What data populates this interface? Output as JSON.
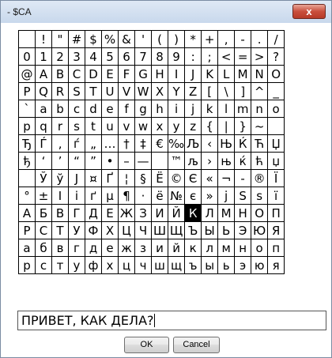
{
  "window": {
    "title": "- $CA",
    "close_label": "x"
  },
  "grid": {
    "rows": [
      [
        " ",
        "!",
        "\"",
        "#",
        "$",
        "%",
        "&",
        "'",
        "(",
        ")",
        "*",
        "+",
        ",",
        "-",
        ".",
        "/"
      ],
      [
        "0",
        "1",
        "2",
        "3",
        "4",
        "5",
        "6",
        "7",
        "8",
        "9",
        ":",
        ";",
        "<",
        "=",
        ">",
        "?"
      ],
      [
        "@",
        "A",
        "B",
        "C",
        "D",
        "E",
        "F",
        "G",
        "H",
        "I",
        "J",
        "K",
        "L",
        "M",
        "N",
        "O"
      ],
      [
        "P",
        "Q",
        "R",
        "S",
        "T",
        "U",
        "V",
        "W",
        "X",
        "Y",
        "Z",
        "[",
        "\\",
        "]",
        "^",
        "_"
      ],
      [
        "`",
        "a",
        "b",
        "c",
        "d",
        "e",
        "f",
        "g",
        "h",
        "i",
        "j",
        "k",
        "l",
        "m",
        "n",
        "o"
      ],
      [
        "p",
        "q",
        "r",
        "s",
        "t",
        "u",
        "v",
        "w",
        "x",
        "y",
        "z",
        "{",
        "|",
        "}",
        "~",
        " "
      ],
      [
        "Ђ",
        "Ѓ",
        "‚",
        "ѓ",
        "„",
        "…",
        "†",
        "‡",
        "€",
        "‰",
        "Љ",
        "‹",
        "Њ",
        "Ќ",
        "Ћ",
        "Џ"
      ],
      [
        "ђ",
        "‘",
        "’",
        "“",
        "”",
        "•",
        "–",
        "—",
        " ",
        "™",
        "љ",
        "›",
        "њ",
        "ќ",
        "ћ",
        "џ"
      ],
      [
        " ",
        "Ў",
        "ў",
        "Ј",
        "¤",
        "Ґ",
        "¦",
        "§",
        "Ё",
        "©",
        "Є",
        "«",
        "¬",
        "-",
        "®",
        "Ї"
      ],
      [
        "°",
        "±",
        "І",
        "і",
        "ґ",
        "µ",
        "¶",
        "·",
        "ё",
        "№",
        "є",
        "»",
        "ј",
        "Ѕ",
        "ѕ",
        "ї"
      ],
      [
        "А",
        "Б",
        "В",
        "Г",
        "Д",
        "Е",
        "Ж",
        "З",
        "И",
        "Й",
        "К",
        "Л",
        "М",
        "Н",
        "О",
        "П"
      ],
      [
        "Р",
        "С",
        "Т",
        "У",
        "Ф",
        "Х",
        "Ц",
        "Ч",
        "Ш",
        "Щ",
        "Ъ",
        "Ы",
        "Ь",
        "Э",
        "Ю",
        "Я"
      ],
      [
        "а",
        "б",
        "в",
        "г",
        "д",
        "е",
        "ж",
        "з",
        "и",
        "й",
        "к",
        "л",
        "м",
        "н",
        "о",
        "п"
      ],
      [
        "р",
        "с",
        "т",
        "у",
        "ф",
        "х",
        "ц",
        "ч",
        "ш",
        "щ",
        "ъ",
        "ы",
        "ь",
        "э",
        "ю",
        "я"
      ]
    ],
    "selected_char": "К",
    "selected_row": 10,
    "selected_col": 10
  },
  "input": {
    "value": "ПРИВЕТ, КАК ДЕЛА?"
  },
  "buttons": {
    "ok_label": "OK",
    "cancel_label": "Cancel"
  }
}
